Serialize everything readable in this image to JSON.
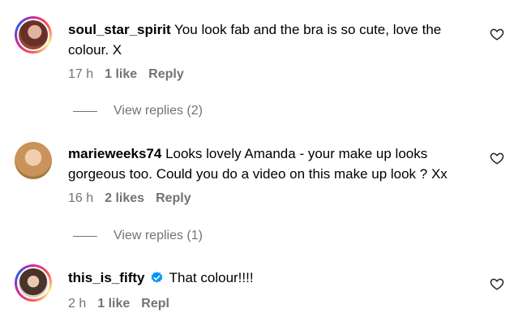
{
  "comments": [
    {
      "username": "soul_star_spirit",
      "text": "You look fab and the bra is so cute, love the colour. X",
      "time": "17 h",
      "likes": "1 like",
      "reply": "Reply",
      "view_replies": "View replies (2)",
      "avatar_icon": "profile-photo"
    },
    {
      "username": "marieweeks74",
      "text": "Looks lovely Amanda - your make up looks gorgeous too. Could you do a video on this make up look ? Xx",
      "time": "16 h",
      "likes": "2 likes",
      "reply": "Reply",
      "view_replies": "View replies (1)",
      "avatar_icon": "profile-photo"
    },
    {
      "username": "this_is_fifty",
      "verified": true,
      "text": "That colour!!!!",
      "time": "2 h",
      "likes": "1 like",
      "reply": "Repl",
      "avatar_icon": "profile-photo"
    }
  ],
  "colors": {
    "meta": "#737373",
    "verified": "#0095f6",
    "heart": "#262626"
  },
  "icons": {
    "like": "heart-outline-icon",
    "verified": "verified-badge-icon"
  }
}
